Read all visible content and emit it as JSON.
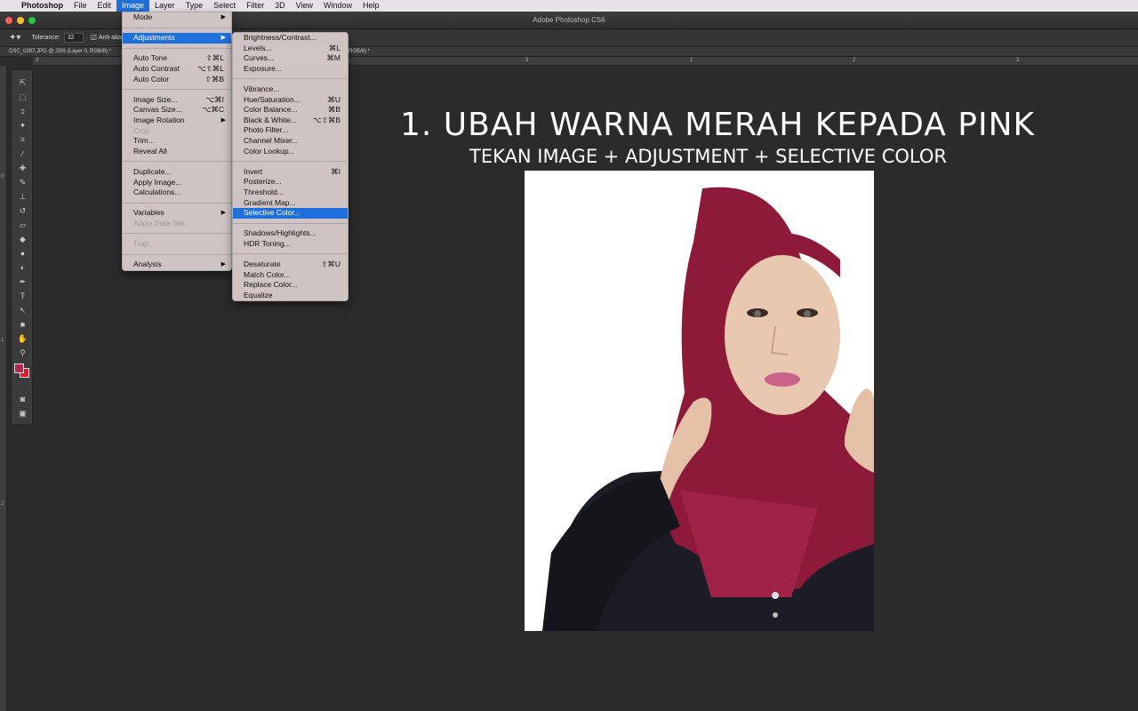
{
  "menubar": {
    "apple": "",
    "app": "Photoshop",
    "items": [
      "File",
      "Edit",
      "Image",
      "Layer",
      "Type",
      "Select",
      "Filter",
      "3D",
      "View",
      "Window",
      "Help"
    ]
  },
  "window": {
    "title": "Adobe Photoshop CS6"
  },
  "options": {
    "tolerance_label": "Tolerance:",
    "tolerance_value": "32",
    "antialias_label": "Anti-alias"
  },
  "doc_tab": {
    "name": "DSC_0267.JPG @ 25% (Layer 0, RGB/8) *",
    "second_suffix": "RGB/8) *"
  },
  "rulers": {
    "top": [
      "3",
      "0",
      "1",
      "2",
      "3"
    ],
    "left": [
      "0",
      "1",
      "2"
    ]
  },
  "image_menu": {
    "items": [
      {
        "label": "Mode",
        "arrow": "▶"
      },
      {
        "sep": true
      },
      {
        "label": "Adjustments",
        "arrow": "▶",
        "highlight": true
      },
      {
        "sep": true
      },
      {
        "label": "Auto Tone",
        "shortcut": "⇧⌘L"
      },
      {
        "label": "Auto Contrast",
        "shortcut": "⌥⇧⌘L"
      },
      {
        "label": "Auto Color",
        "shortcut": "⇧⌘B"
      },
      {
        "sep": true
      },
      {
        "label": "Image Size...",
        "shortcut": "⌥⌘I"
      },
      {
        "label": "Canvas Size...",
        "shortcut": "⌥⌘C"
      },
      {
        "label": "Image Rotation",
        "arrow": "▶"
      },
      {
        "label": "Crop",
        "disabled": true
      },
      {
        "label": "Trim..."
      },
      {
        "label": "Reveal All"
      },
      {
        "sep": true
      },
      {
        "label": "Duplicate..."
      },
      {
        "label": "Apply Image..."
      },
      {
        "label": "Calculations..."
      },
      {
        "sep": true
      },
      {
        "label": "Variables",
        "arrow": "▶"
      },
      {
        "label": "Apply Data Set...",
        "disabled": true
      },
      {
        "sep": true
      },
      {
        "label": "Trap...",
        "disabled": true
      },
      {
        "sep": true
      },
      {
        "label": "Analysis",
        "arrow": "▶"
      }
    ]
  },
  "adjustments_menu": {
    "items": [
      {
        "label": "Brightness/Contrast..."
      },
      {
        "label": "Levels...",
        "shortcut": "⌘L"
      },
      {
        "label": "Curves...",
        "shortcut": "⌘M"
      },
      {
        "label": "Exposure..."
      },
      {
        "sep": true
      },
      {
        "label": "Vibrance..."
      },
      {
        "label": "Hue/Saturation...",
        "shortcut": "⌘U"
      },
      {
        "label": "Color Balance...",
        "shortcut": "⌘B"
      },
      {
        "label": "Black & White...",
        "shortcut": "⌥⇧⌘B"
      },
      {
        "label": "Photo Filter..."
      },
      {
        "label": "Channel Mixer..."
      },
      {
        "label": "Color Lookup..."
      },
      {
        "sep": true
      },
      {
        "label": "Invert",
        "shortcut": "⌘I"
      },
      {
        "label": "Posterize..."
      },
      {
        "label": "Threshold..."
      },
      {
        "label": "Gradient Map..."
      },
      {
        "label": "Selective Color...",
        "highlight": true
      },
      {
        "sep": true
      },
      {
        "label": "Shadows/Highlights..."
      },
      {
        "label": "HDR Toning..."
      },
      {
        "sep": true
      },
      {
        "label": "Desaturate",
        "shortcut": "⇧⌘U"
      },
      {
        "label": "Match Color..."
      },
      {
        "label": "Replace Color..."
      },
      {
        "label": "Equalize"
      }
    ]
  },
  "overlay": {
    "headline": "1. UBAH WARNA MERAH KEPADA PINK",
    "subline": "TEKAN IMAGE + ADJUSTMENT + SELECTIVE COLOR"
  },
  "colors": {
    "foreground": "#b02a55",
    "background": "#e0162a",
    "hijab": "#8e1a3a",
    "highlight": "#1f6fdc"
  }
}
